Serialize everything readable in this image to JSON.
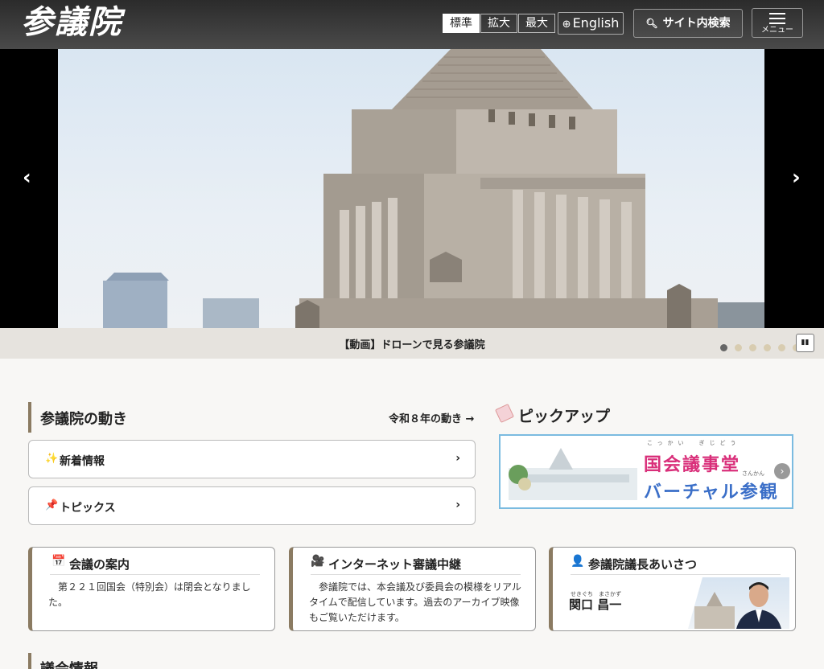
{
  "header": {
    "logo": "参議院",
    "text_size": [
      "標準",
      "拡大",
      "最大"
    ],
    "english": "English",
    "search": "サイト内検索",
    "menu": "メニュー"
  },
  "hero": {
    "caption": "【動画】ドローンで見る参議院",
    "slide_count": 6,
    "active_slide": 1
  },
  "activity": {
    "title": "参議院の動き",
    "link": "令和８年の動き →",
    "items": [
      {
        "icon": "sparkles-icon",
        "label": "新着情報"
      },
      {
        "icon": "pushpin-icon",
        "label": "トピックス"
      }
    ]
  },
  "pickup": {
    "title": "ピックアップ",
    "banner_line1": "国会議事堂",
    "banner_line2": "バーチャル参観",
    "banner_ruby1": "こっかい　ぎじどう",
    "banner_ruby2": "さんかん"
  },
  "cards": {
    "session": {
      "title": "会議の案内",
      "body": "第２２１回国会（特別会）は閉会となりました。"
    },
    "broadcast": {
      "title": "インターネット審議中継",
      "body": "参議院では、本会議及び委員会の模様をリアルタイムで配信しています。過去のアーカイブ映像もご覧いただけます。"
    },
    "president": {
      "title": "参議院議長あいさつ",
      "name": "関口 昌一",
      "ruby": "せきぐち　まさかず"
    }
  },
  "next_section": {
    "title": "議会情報"
  }
}
